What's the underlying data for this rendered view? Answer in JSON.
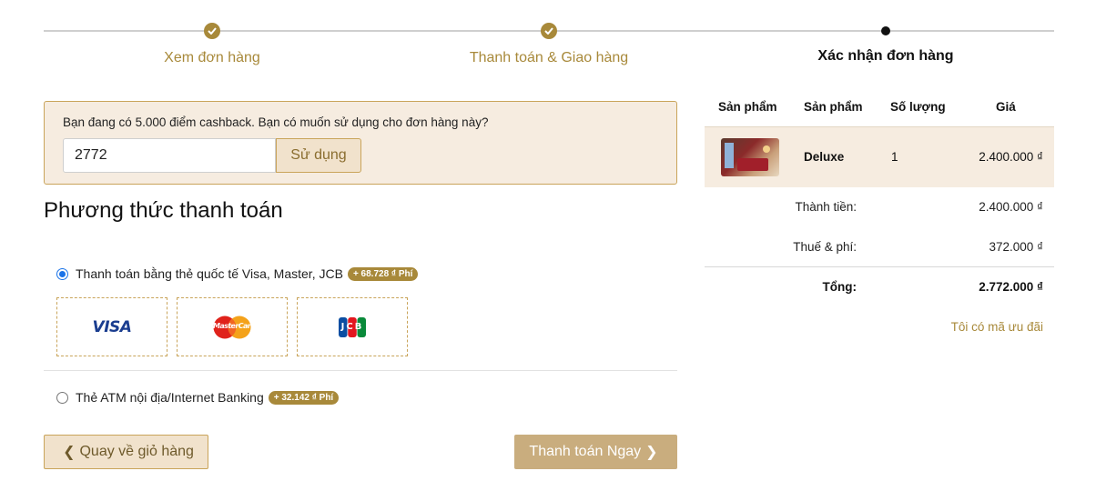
{
  "stepper": {
    "steps": [
      {
        "label": "Xem đơn hàng",
        "state": "done"
      },
      {
        "label": "Thanh toán & Giao hàng",
        "state": "done"
      },
      {
        "label": "Xác nhận đơn hàng",
        "state": "active"
      }
    ]
  },
  "cashback": {
    "message": "Bạn đang có 5.000 điểm cashback. Bạn có muốn sử dụng cho đơn hàng này?",
    "input_value": "2772",
    "use_label": "Sử dụng"
  },
  "payment": {
    "title": "Phương thức thanh toán",
    "options": [
      {
        "label": "Thanh toán bằng thẻ quốc tế Visa, Master, JCB",
        "fee": "+ 68.728 ₫ Phí",
        "selected": true
      },
      {
        "label": "Thẻ ATM nội địa/Internet Banking",
        "fee": "+ 32.142 ₫ Phí",
        "selected": false
      }
    ],
    "cards": [
      {
        "name": "visa",
        "text": "VISA"
      },
      {
        "name": "mastercard",
        "text": "MasterCard"
      },
      {
        "name": "jcb",
        "text": "JCB"
      }
    ]
  },
  "actions": {
    "back_label": "Quay về giỏ hàng",
    "pay_label": "Thanh toán Ngay"
  },
  "order": {
    "headers": [
      "Sản phẩm",
      "Sản phẩm",
      "Số lượng",
      "Giá"
    ],
    "item": {
      "name": "Deluxe",
      "quantity": "1",
      "price": "2.400.000 ₫"
    },
    "subtotal_label": "Thành tiền:",
    "subtotal_value": "2.400.000 ₫",
    "tax_label": "Thuế & phí:",
    "tax_value": "372.000 ₫",
    "total_label": "Tổng:",
    "total_value": "2.772.000 ₫",
    "promo_label": "Tôi có mã ưu đãi"
  },
  "colors": {
    "accent": "#a8893a",
    "panel_bg": "#f6ece0",
    "pay_button": "#c9ad7e"
  }
}
